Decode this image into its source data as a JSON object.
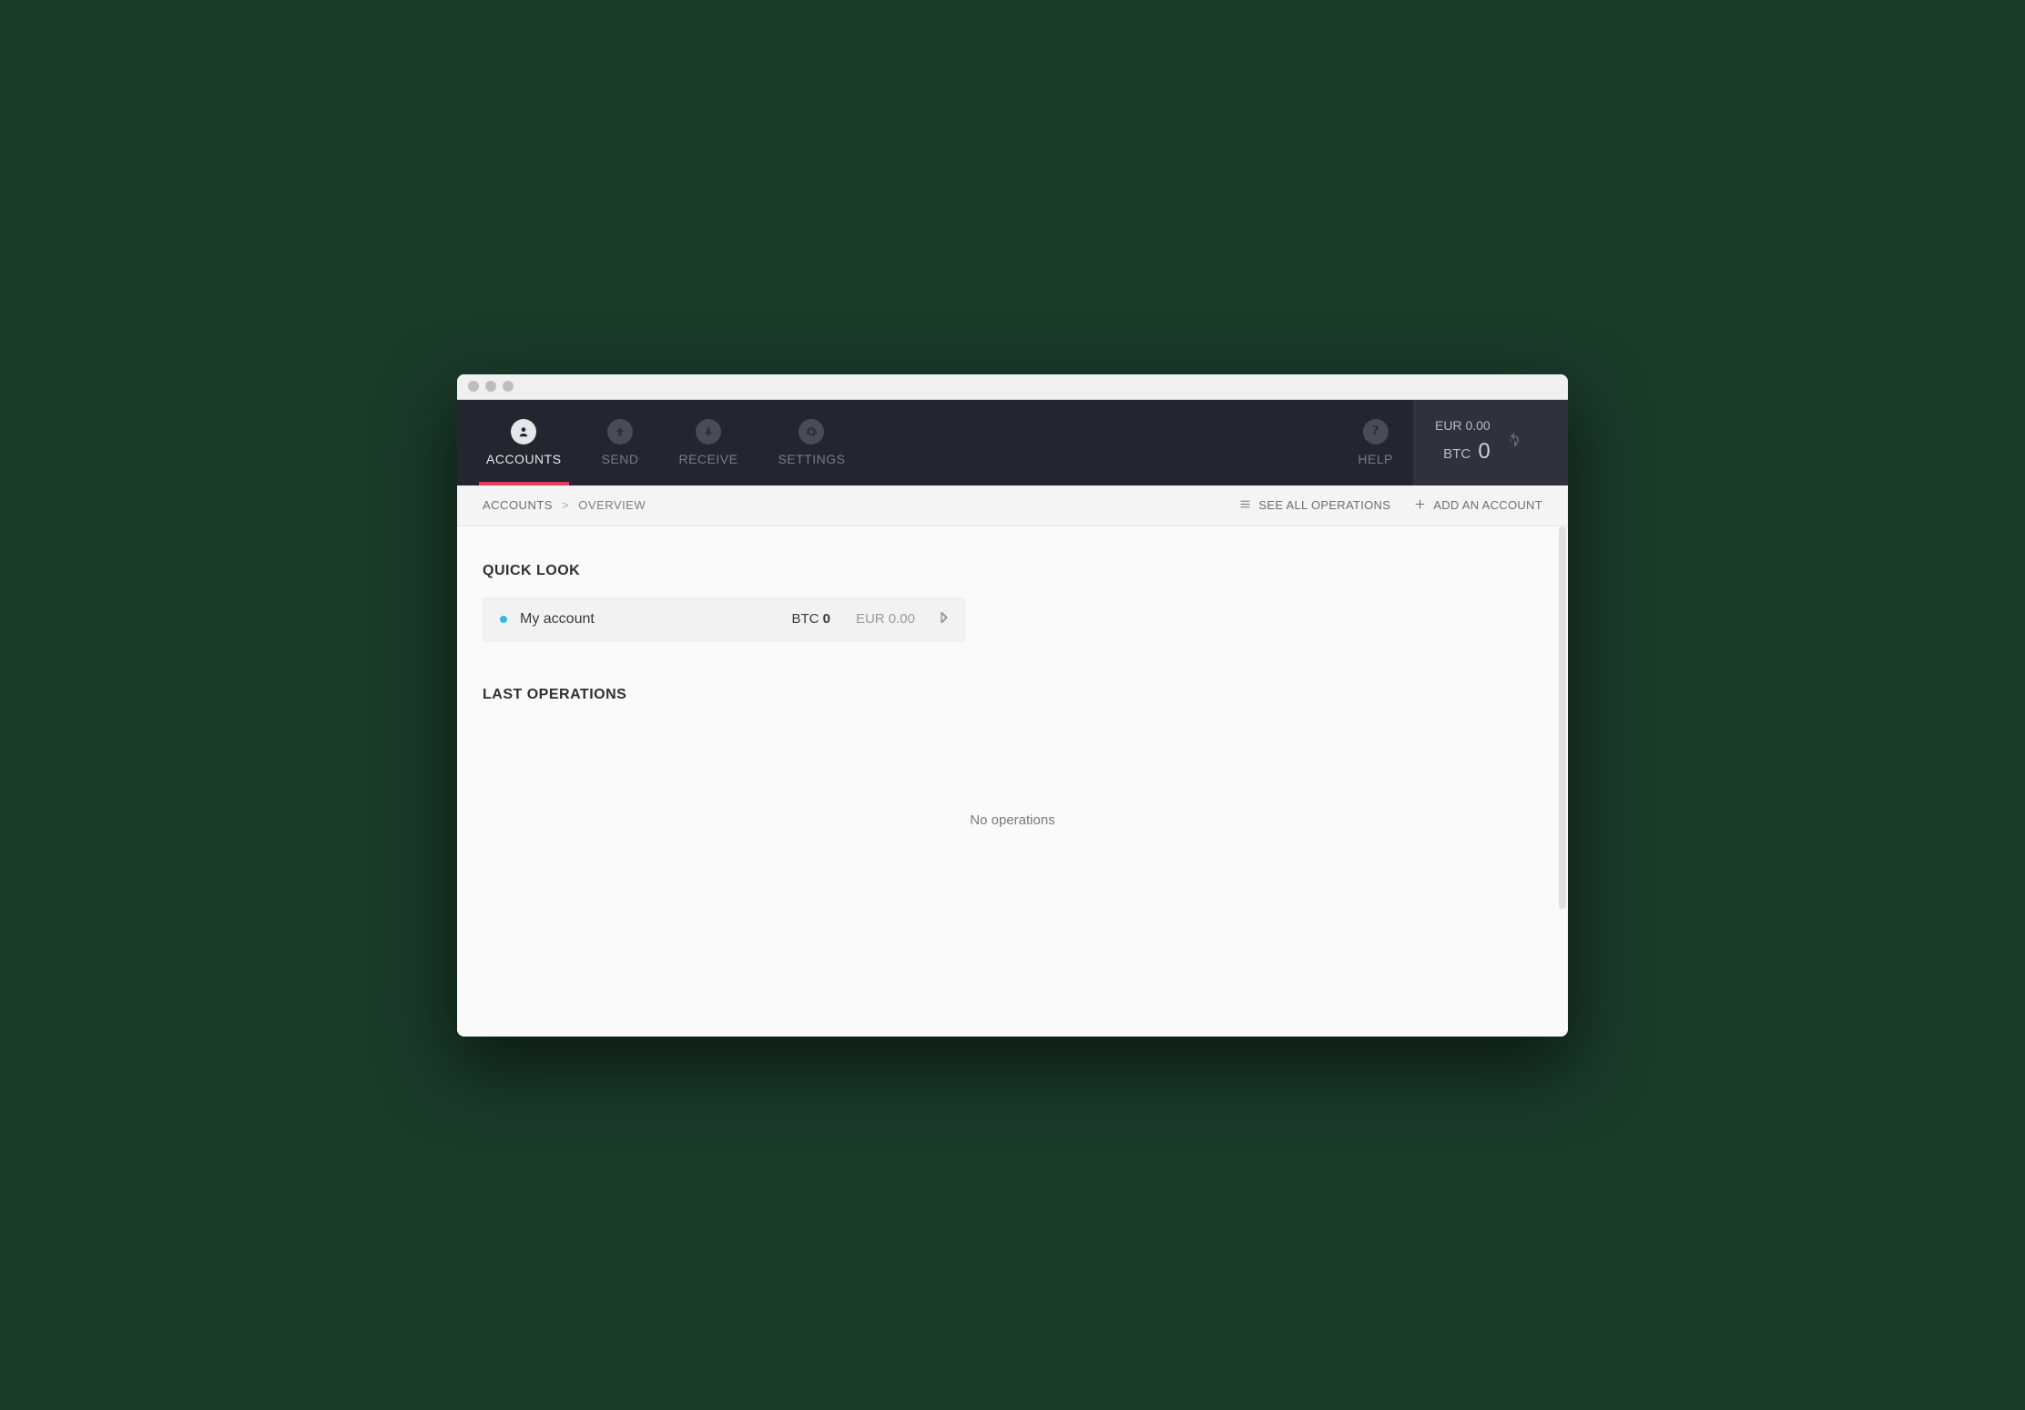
{
  "nav": {
    "accounts": "ACCOUNTS",
    "send": "SEND",
    "receive": "RECEIVE",
    "settings": "SETTINGS",
    "help": "HELP"
  },
  "balance": {
    "fiat_label": "EUR",
    "fiat_value": "0.00",
    "crypto_label": "BTC",
    "crypto_value": "0"
  },
  "breadcrumb": {
    "root": "ACCOUNTS",
    "page": "OVERVIEW"
  },
  "actions": {
    "see_all": "SEE ALL OPERATIONS",
    "add_account": "ADD AN ACCOUNT"
  },
  "sections": {
    "quick_look": "QUICK LOOK",
    "last_ops": "LAST OPERATIONS"
  },
  "account": {
    "name": "My account",
    "crypto_label": "BTC",
    "crypto_value": "0",
    "fiat_label": "EUR",
    "fiat_value": "0.00"
  },
  "empty": {
    "no_operations": "No operations"
  }
}
